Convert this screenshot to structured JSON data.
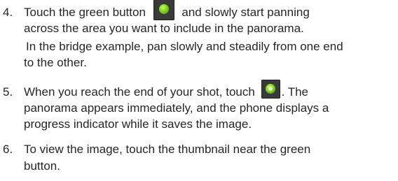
{
  "steps": [
    {
      "number": "4.",
      "line1_a": "Touch the green button",
      "line1_b": "and slowly start panning",
      "line2": "across the area you want to include in the panorama.",
      "line3": "In the bridge example, pan slowly and steadily from one end",
      "line4": "to the other."
    },
    {
      "number": "5.",
      "line1_a": "When you reach the end of your shot, touch",
      "line1_b": ". The",
      "line2": "panorama appears immediately, and the phone displays a",
      "line3": "progress indicator while it saves the image."
    },
    {
      "number": "6.",
      "line1": "To view the image, touch the thumbnail near the green",
      "line2": "button."
    }
  ],
  "icons": {
    "start_shutter": "green-shutter-icon",
    "stop_shutter": "green-shutter-stop-icon"
  }
}
